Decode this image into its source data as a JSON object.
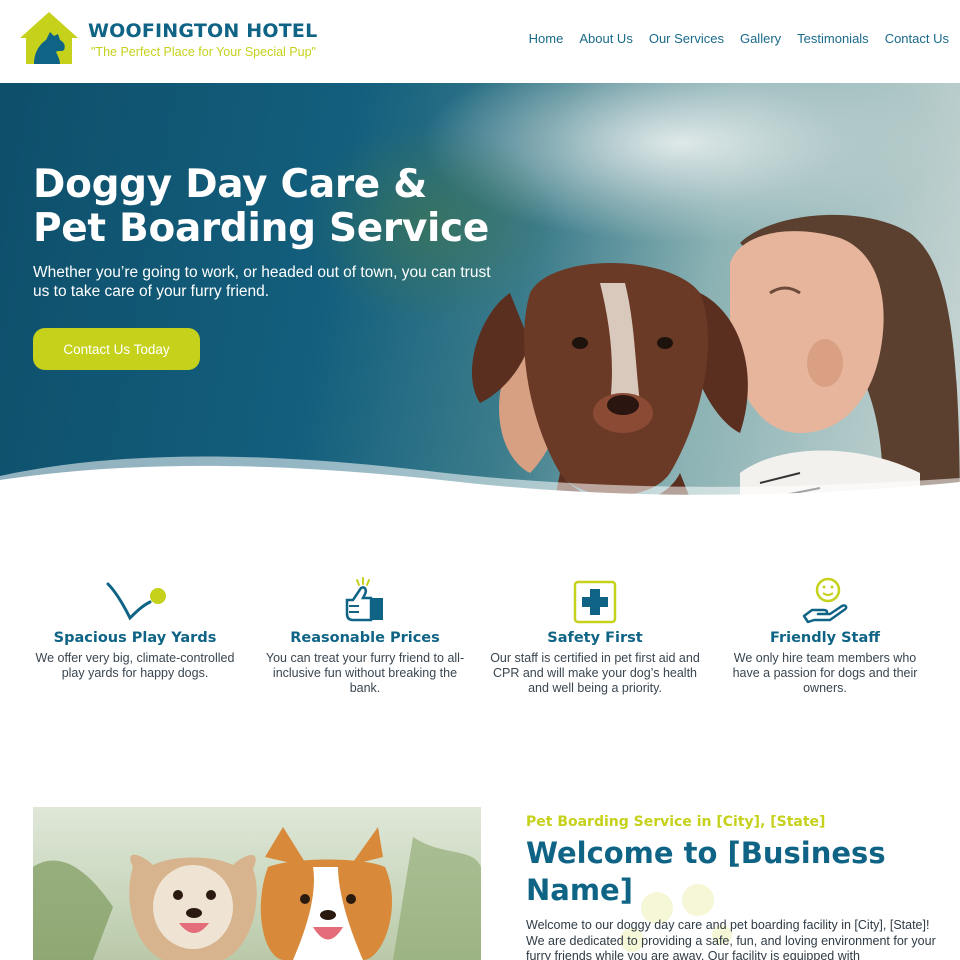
{
  "header": {
    "brand_name": "WOOFINGTON HOTEL",
    "tagline": "\"The Perfect Place for Your Special Pup\"",
    "nav": [
      "Home",
      "About Us",
      "Our Services",
      "Gallery",
      "Testimonials",
      "Contact Us"
    ]
  },
  "hero": {
    "title_line1": "Doggy Day Care &",
    "title_line2": "Pet Boarding Service",
    "subtitle": "Whether you’re going to work, or headed out of town, you can trust us to take care of your furry friend.",
    "cta": "Contact Us Today"
  },
  "features": [
    {
      "icon": "ball-throw-icon",
      "title": "Spacious Play Yards",
      "text": "We offer very big, climate-controlled play yards for happy dogs."
    },
    {
      "icon": "thumbs-up-icon",
      "title": "Reasonable Prices",
      "text": "You can treat your furry friend to all-inclusive fun without breaking the bank."
    },
    {
      "icon": "first-aid-icon",
      "title": "Safety First",
      "text": "Our staff is certified in pet first aid and CPR and will make your dog’s health and well being a priority."
    },
    {
      "icon": "caring-hand-icon",
      "title": "Friendly Staff",
      "text": "We only hire team members who have a passion for dogs and their owners."
    }
  ],
  "welcome": {
    "kicker": "Pet Boarding Service in [City], [State]",
    "title": "Welcome to [Business Name]",
    "text": "Welcome to our doggy day care and pet boarding facility in [City], [State]! We are dedicated to providing a safe, fun, and loving environment for your furry friends while you are away. Our facility is equipped with"
  },
  "colors": {
    "brand_blue": "#0f6486",
    "accent_lime": "#c6d11c"
  }
}
